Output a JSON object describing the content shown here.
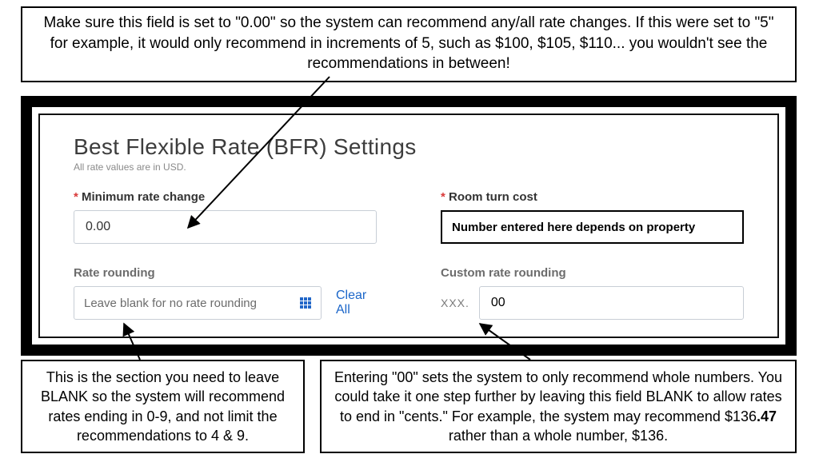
{
  "annotations": {
    "top": "Make sure this field is set to \"0.00\" so the system can recommend any/all rate changes. If this were set to \"5\" for example, it would only recommend in increments of 5, such as $100, $105, $110... you wouldn't see the recommendations in between!",
    "bottom_left": "This is the section you need to leave BLANK so the system will recommend rates ending in 0-9, and not limit the recommendations to 4 & 9.",
    "bottom_right_pre": "Entering \"00\" sets the system to only recommend whole numbers. You could take it one step further by leaving this field BLANK to allow rates to end in \"cents.\" For example, the system may recommend $136",
    "bottom_right_bold": ".47",
    "bottom_right_post": " rather than a whole number, $136."
  },
  "panel": {
    "title": "Best Flexible Rate (BFR) Settings",
    "subtitle": "All rate values are in USD.",
    "min_rate_change": {
      "label": "Minimum rate change",
      "value": "0.00"
    },
    "room_turn_cost": {
      "label": "Room turn cost",
      "text": "Number entered here depends on property"
    },
    "rate_rounding": {
      "label": "Rate rounding",
      "placeholder": "Leave blank for no rate rounding",
      "clear": "Clear All"
    },
    "custom_rate_rounding": {
      "label": "Custom rate rounding",
      "prefix": "XXX.",
      "value": "00"
    }
  }
}
